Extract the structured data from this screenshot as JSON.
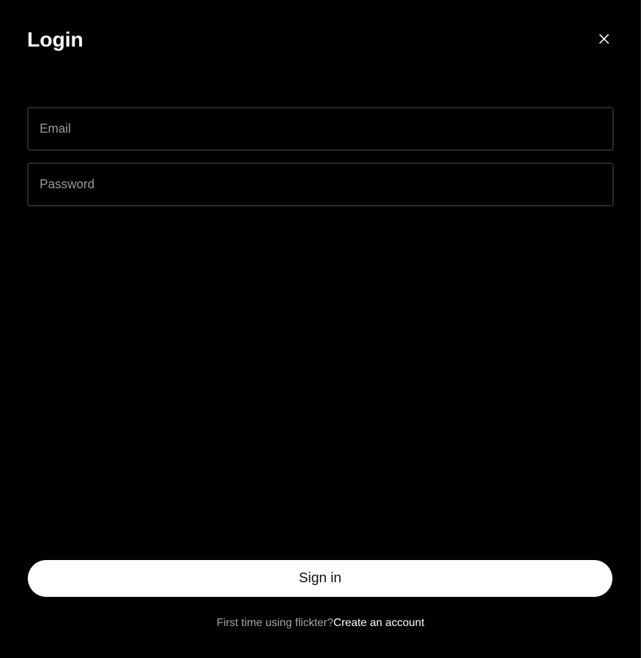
{
  "modal": {
    "title": "Login",
    "close_icon": "close-icon"
  },
  "form": {
    "email": {
      "value": "",
      "placeholder": "Email"
    },
    "password": {
      "value": "",
      "placeholder": "Password"
    },
    "submit_label": "Sign in"
  },
  "footer": {
    "prompt": "First time using flickter?",
    "link_label": "Create an account"
  },
  "colors": {
    "background": "#000000",
    "text": "#ffffff",
    "muted_text": "#a8a8a8",
    "field_border": "#2b2b2b",
    "button_background": "#ffffff",
    "button_text": "#111111"
  }
}
